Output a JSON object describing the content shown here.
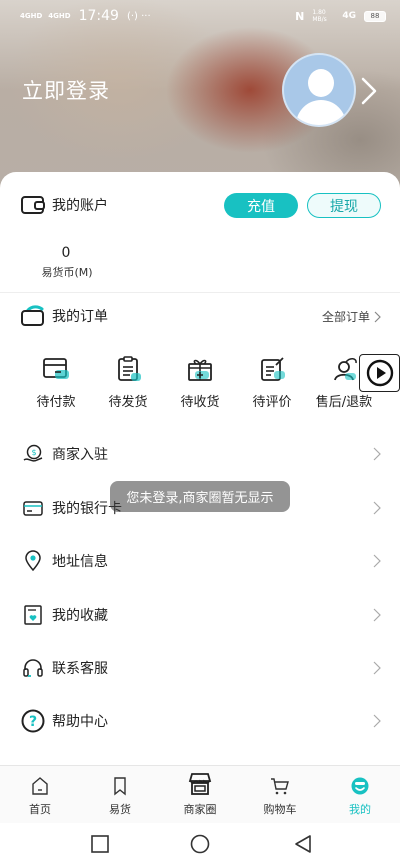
{
  "status_bar": {
    "signal1": "4GHD",
    "signal2": "4GHD",
    "time": "17:49",
    "extra": "(·) ···",
    "nfc": "N",
    "speed": "1.80 MB/s",
    "network": "4G",
    "battery": "88"
  },
  "header": {
    "login_text": "立即登录"
  },
  "account": {
    "title": "我的账户",
    "recharge_label": "充值",
    "withdraw_label": "提现",
    "balance_value": "0",
    "balance_label": "易货币(M)"
  },
  "orders": {
    "title": "我的订单",
    "all_orders_label": "全部订单",
    "items": [
      {
        "label": "待付款",
        "icon": "wallet-icon"
      },
      {
        "label": "待发货",
        "icon": "clipboard-icon"
      },
      {
        "label": "待收货",
        "icon": "gift-box-icon"
      },
      {
        "label": "待评价",
        "icon": "review-icon"
      },
      {
        "label": "售后/退款",
        "icon": "after-sale-icon"
      }
    ]
  },
  "menu": [
    {
      "label": "商家入驻",
      "icon": "merchant-icon"
    },
    {
      "label": "我的银行卡",
      "icon": "bank-card-icon"
    },
    {
      "label": "地址信息",
      "icon": "location-icon"
    },
    {
      "label": "我的收藏",
      "icon": "favorite-icon"
    },
    {
      "label": "联系客服",
      "icon": "headset-icon"
    },
    {
      "label": "帮助中心",
      "icon": "help-icon"
    }
  ],
  "toast": "您未登录,商家圈暂无显示",
  "tabs": [
    {
      "label": "首页",
      "icon": "home-icon"
    },
    {
      "label": "易货",
      "icon": "bookmark-icon"
    },
    {
      "label": "商家圈",
      "icon": "shop-icon"
    },
    {
      "label": "购物车",
      "icon": "cart-icon"
    },
    {
      "label": "我的",
      "icon": "profile-icon",
      "active": true
    }
  ],
  "colors": {
    "accent": "#18c1c2"
  }
}
